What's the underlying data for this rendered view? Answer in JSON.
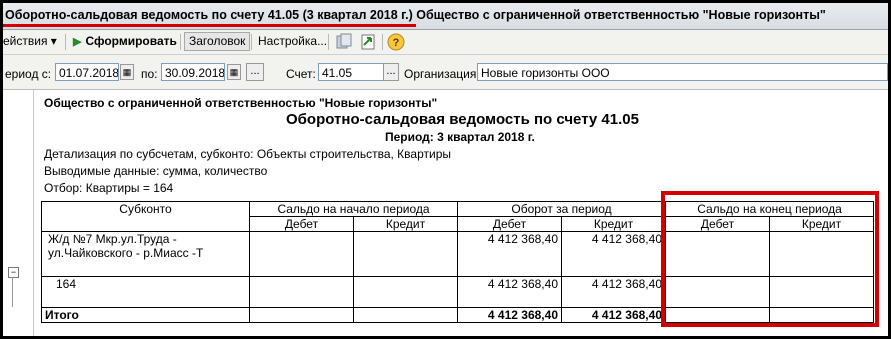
{
  "window": {
    "title_part1": "Оборотно-сальдовая ведомость по счету 41.05 (3 квартал 2018 г.)",
    "title_part2": " Общество с ограниченной ответственностью \"Новые горизонты\""
  },
  "toolbar": {
    "actions": "ействия ▾",
    "generate": "Сформировать",
    "header": "Заголовок",
    "settings": "Настройка...",
    "help": "?"
  },
  "params": {
    "period_from_label": "ериод с:",
    "period_from": "01.07.2018",
    "period_to_label": "по:",
    "period_to": "30.09.2018",
    "ellipsis": "...",
    "account_label": "Счет:",
    "account": "41.05",
    "org_label": "Организация:",
    "org": "Новые горизонты ООО"
  },
  "report": {
    "org": "Общество с ограниченной ответственностью \"Новые горизонты\"",
    "title": "Оборотно-сальдовая ведомость по счету 41.05",
    "period": "Период: 3 квартал 2018 г.",
    "detail": "Детализация по субсчетам, субконто: Объекты строительства, Квартиры",
    "output": "Выводимые данные: сумма, количество",
    "filter": "Отбор: Квартиры = 164",
    "headers": {
      "subconto": "Субконто",
      "opening": "Сальдо на начало периода",
      "turnover": "Оборот за период",
      "closing": "Сальдо на конец периода",
      "debit": "Дебет",
      "credit": "Кредит"
    },
    "rows": [
      {
        "name1": "Ж/д №7 Мкр.ул.Труда -",
        "name2": "ул.Чайковского - р.Миасс -Т",
        "open_d": "",
        "open_c": "",
        "turn_d": "4 412 368,40",
        "turn_c": "4 412 368,40",
        "close_d": "",
        "close_c": ""
      },
      {
        "name1": "164",
        "name2": "",
        "open_d": "",
        "open_c": "",
        "turn_d": "4 412 368,40",
        "turn_c": "4 412 368,40",
        "close_d": "",
        "close_c": ""
      }
    ],
    "total": {
      "name": "Итого",
      "turn_d": "4 412 368,40",
      "turn_c": "4 412 368,40"
    }
  },
  "colors": {
    "highlight": "#d40000"
  }
}
